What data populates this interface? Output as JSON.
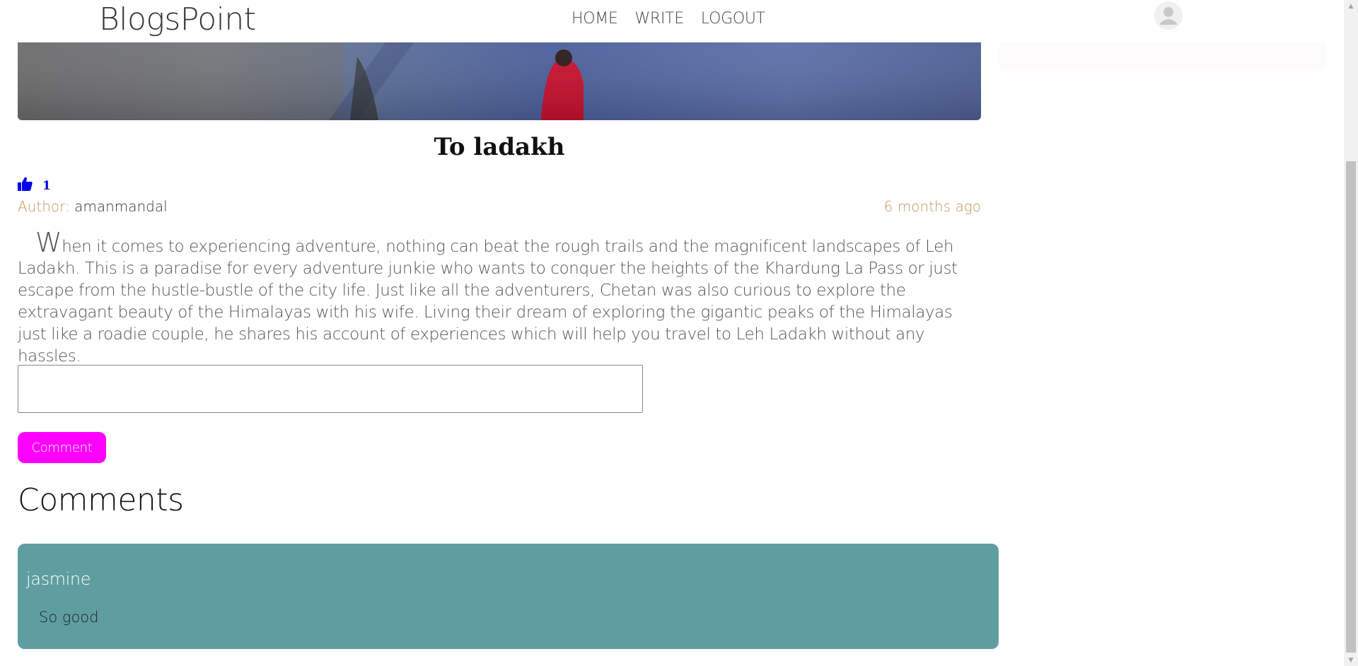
{
  "nav": {
    "logo": "BlogsPoint",
    "items": [
      {
        "label": "HOME"
      },
      {
        "label": "WRITE"
      },
      {
        "label": "LOGOUT"
      }
    ]
  },
  "post": {
    "title": "To ladakh",
    "likes": "1",
    "author_label": "Author:",
    "author_name": "amanmandal",
    "time": "6 months ago",
    "body_first_letter": "W",
    "body_rest": "hen it comes to experiencing adventure, nothing can beat the rough trails and the magnificent landscapes of Leh Ladakh. This is a paradise for every adventure junkie who wants to conquer the heights of the Khardung La Pass or just escape from the hustle-bustle of the city life. Just like all the adventurers, Chetan was also curious to explore the extravagant beauty of the Himalayas with his wife. Living their dream of exploring the gigantic peaks of the Himalayas just like a roadie couple, he shares his account of experiences which will help you travel to Leh Ladakh without any hassles."
  },
  "comment_form": {
    "input_value": "",
    "button_label": "Comment"
  },
  "comments": {
    "heading": "Comments",
    "items": [
      {
        "user": "jasmine",
        "text": "So good"
      }
    ]
  },
  "colors": {
    "accent_button": "#ff00ff",
    "comment_card": "#5f9ea0",
    "meta_text": "#c49461",
    "like_color": "#0000ee"
  },
  "icons": {
    "like": "thumbs-up-icon",
    "avatar": "user-avatar-icon"
  }
}
